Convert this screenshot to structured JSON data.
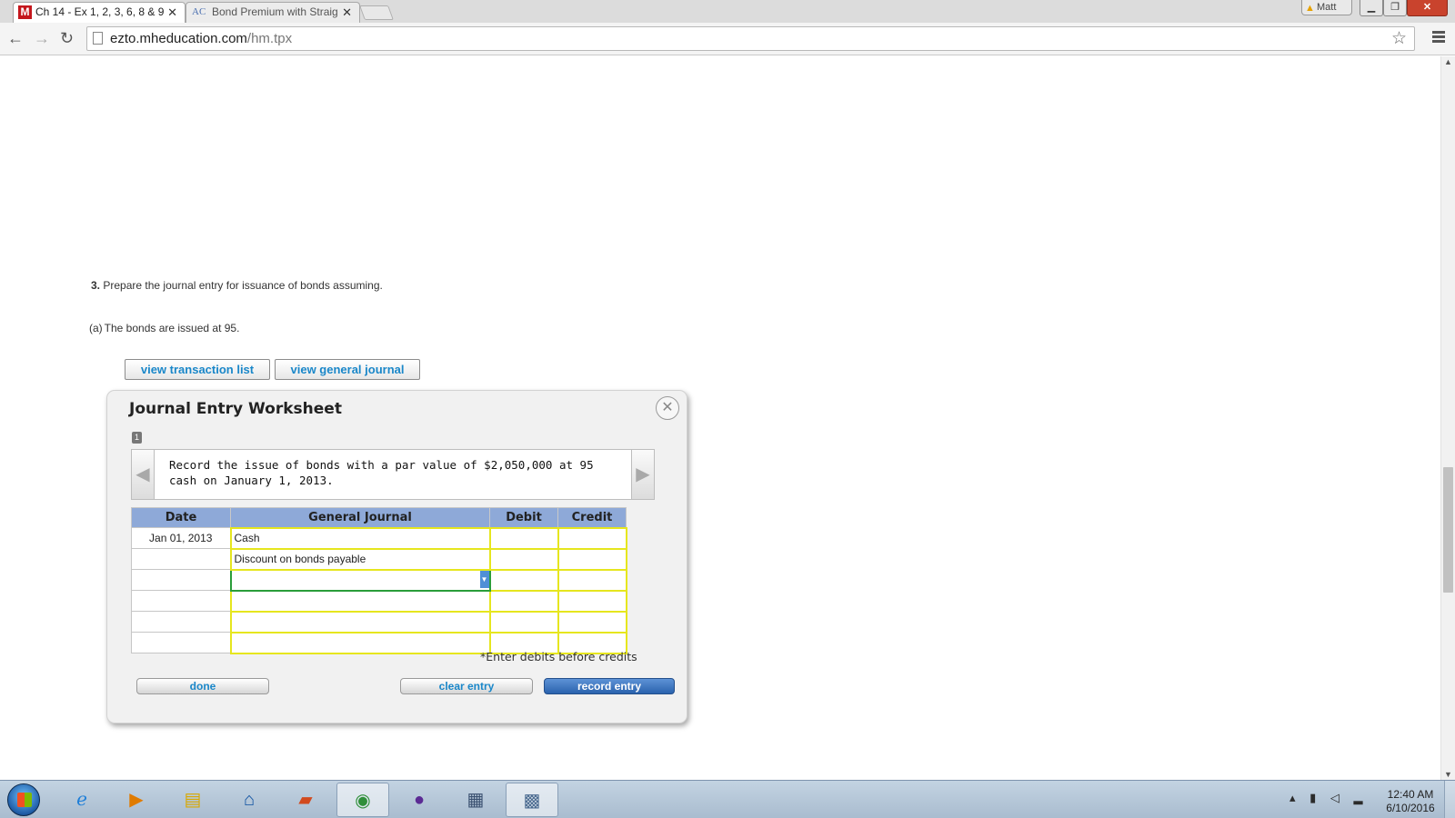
{
  "browser": {
    "tabs": [
      {
        "label": "Ch 14 - Ex 1, 2, 3, 6, 8 & 9",
        "favicon": "M"
      },
      {
        "label": "Bond Premium with Straig",
        "favicon": "AC"
      }
    ],
    "user_label": "Matt",
    "address_host": "ezto.mheducation.com",
    "address_path": "/hm.tpx"
  },
  "question": {
    "number": "3.",
    "text": "Prepare the journal entry for issuance of bonds assuming.",
    "part_label": "(a)",
    "part_text": "The bonds are issued at 95."
  },
  "buttons": {
    "view_transactions": "view transaction list",
    "view_journal": "view general journal"
  },
  "worksheet": {
    "title": "Journal Entry Worksheet",
    "step": "1",
    "instruction": "Record the issue of bonds with a par value of $2,050,000 at 95 cash on January 1, 2013.",
    "columns": [
      "Date",
      "General Journal",
      "Debit",
      "Credit"
    ],
    "rows": [
      {
        "date": "Jan 01, 2013",
        "account": "Cash",
        "debit": "",
        "credit": ""
      },
      {
        "date": "",
        "account": "Discount on bonds payable",
        "debit": "",
        "credit": ""
      },
      {
        "date": "",
        "account": "",
        "debit": "",
        "credit": ""
      },
      {
        "date": "",
        "account": "",
        "debit": "",
        "credit": ""
      },
      {
        "date": "",
        "account": "",
        "debit": "",
        "credit": ""
      },
      {
        "date": "",
        "account": "",
        "debit": "",
        "credit": ""
      }
    ],
    "hint": "*Enter debits before credits",
    "done_label": "done",
    "clear_label": "clear entry",
    "record_label": "record entry"
  },
  "taskbar": {
    "time": "12:40 AM",
    "date": "6/10/2016"
  },
  "colors": {
    "header_blue": "#8ea9d8",
    "cell_border_yellow": "#e6e61e",
    "link_blue": "#1a87c9",
    "record_button": "#2a62ad"
  }
}
